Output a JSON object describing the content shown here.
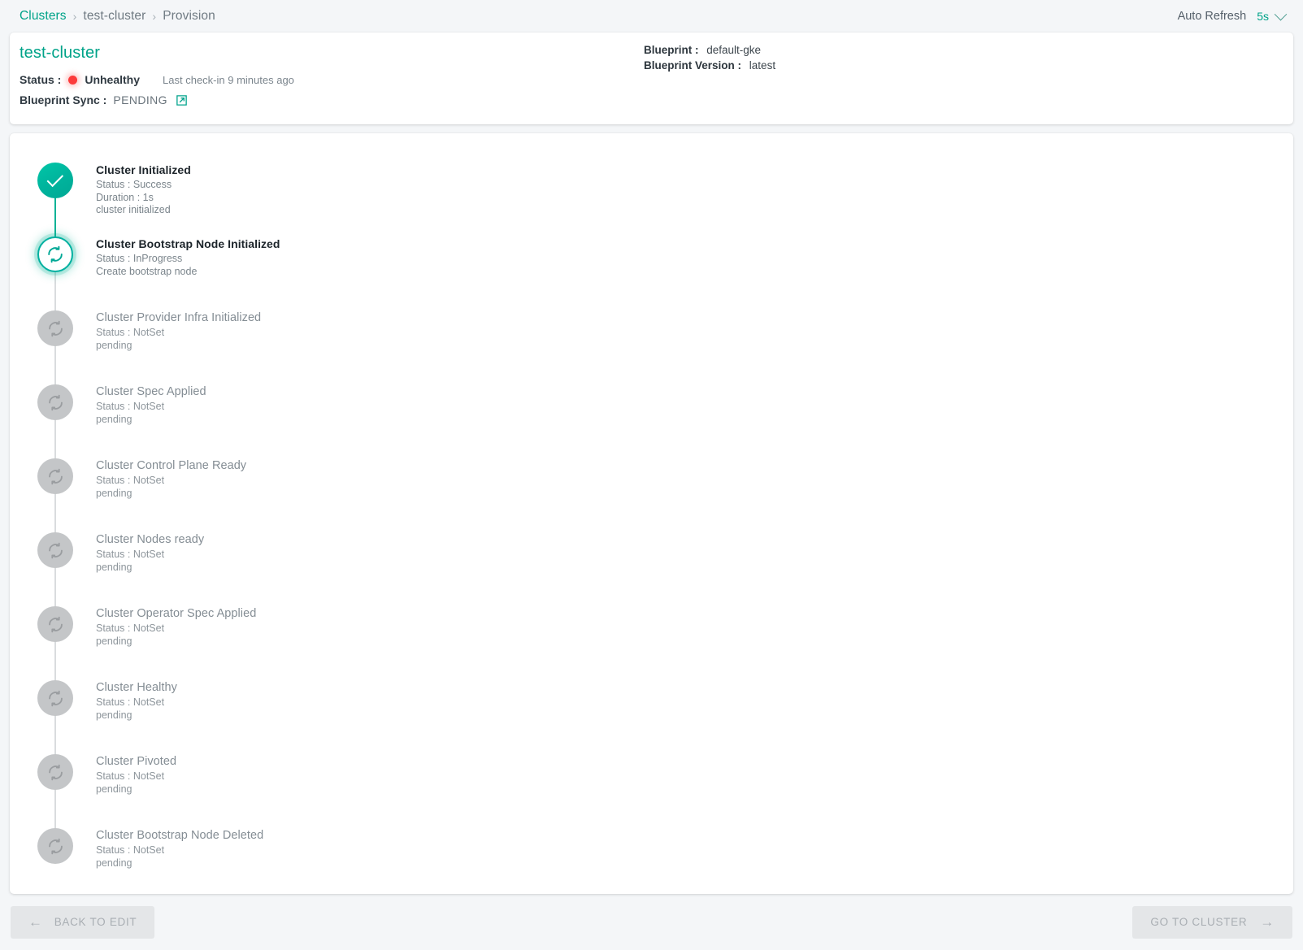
{
  "breadcrumb": {
    "items": [
      {
        "label": "Clusters",
        "link": true
      },
      {
        "label": "test-cluster",
        "link": false
      },
      {
        "label": "Provision",
        "link": false
      }
    ],
    "separator": "›"
  },
  "auto_refresh": {
    "label": "Auto Refresh",
    "value": "5s",
    "icon": "chevron-down-icon"
  },
  "summary": {
    "cluster_name": "test-cluster",
    "status_key": "Status :",
    "status_value": "Unhealthy",
    "status_color": "#fc3a3a",
    "last_checkin_label": "Last check-in",
    "last_checkin_value": "9 minutes ago",
    "blueprint_sync_key": "Blueprint Sync :",
    "blueprint_sync_value": "PENDING",
    "blueprint_sync_icon": "external-link-icon",
    "blueprint_key": "Blueprint :",
    "blueprint_value": "default-gke",
    "blueprint_version_key": "Blueprint Version :",
    "blueprint_version_value": "latest"
  },
  "accent_color": "#00a389",
  "timeline": {
    "steps": [
      {
        "title": "Cluster Initialized",
        "status": "Status : Success",
        "duration": "Duration : 1s",
        "message": "cluster initialized",
        "state": "success",
        "icon": "check-icon"
      },
      {
        "title": "Cluster Bootstrap Node Initialized",
        "status": "Status : InProgress",
        "duration": null,
        "message": "Create bootstrap node",
        "state": "inprogress",
        "icon": "sync-icon"
      },
      {
        "title": "Cluster Provider Infra Initialized",
        "status": "Status : NotSet",
        "duration": null,
        "message": "pending",
        "state": "pending",
        "icon": "sync-icon"
      },
      {
        "title": "Cluster Spec Applied",
        "status": "Status : NotSet",
        "duration": null,
        "message": "pending",
        "state": "pending",
        "icon": "sync-icon"
      },
      {
        "title": "Cluster Control Plane Ready",
        "status": "Status : NotSet",
        "duration": null,
        "message": "pending",
        "state": "pending",
        "icon": "sync-icon"
      },
      {
        "title": "Cluster Nodes ready",
        "status": "Status : NotSet",
        "duration": null,
        "message": "pending",
        "state": "pending",
        "icon": "sync-icon"
      },
      {
        "title": "Cluster Operator Spec Applied",
        "status": "Status : NotSet",
        "duration": null,
        "message": "pending",
        "state": "pending",
        "icon": "sync-icon"
      },
      {
        "title": "Cluster Healthy",
        "status": "Status : NotSet",
        "duration": null,
        "message": "pending",
        "state": "pending",
        "icon": "sync-icon"
      },
      {
        "title": "Cluster Pivoted",
        "status": "Status : NotSet",
        "duration": null,
        "message": "pending",
        "state": "pending",
        "icon": "sync-icon"
      },
      {
        "title": "Cluster Bootstrap Node Deleted",
        "status": "Status : NotSet",
        "duration": null,
        "message": "pending",
        "state": "pending",
        "icon": "sync-icon"
      }
    ]
  },
  "footer": {
    "back_label": "BACK TO EDIT",
    "back_icon": "arrow-left-icon",
    "next_label": "GO TO CLUSTER",
    "next_icon": "arrow-right-icon"
  }
}
